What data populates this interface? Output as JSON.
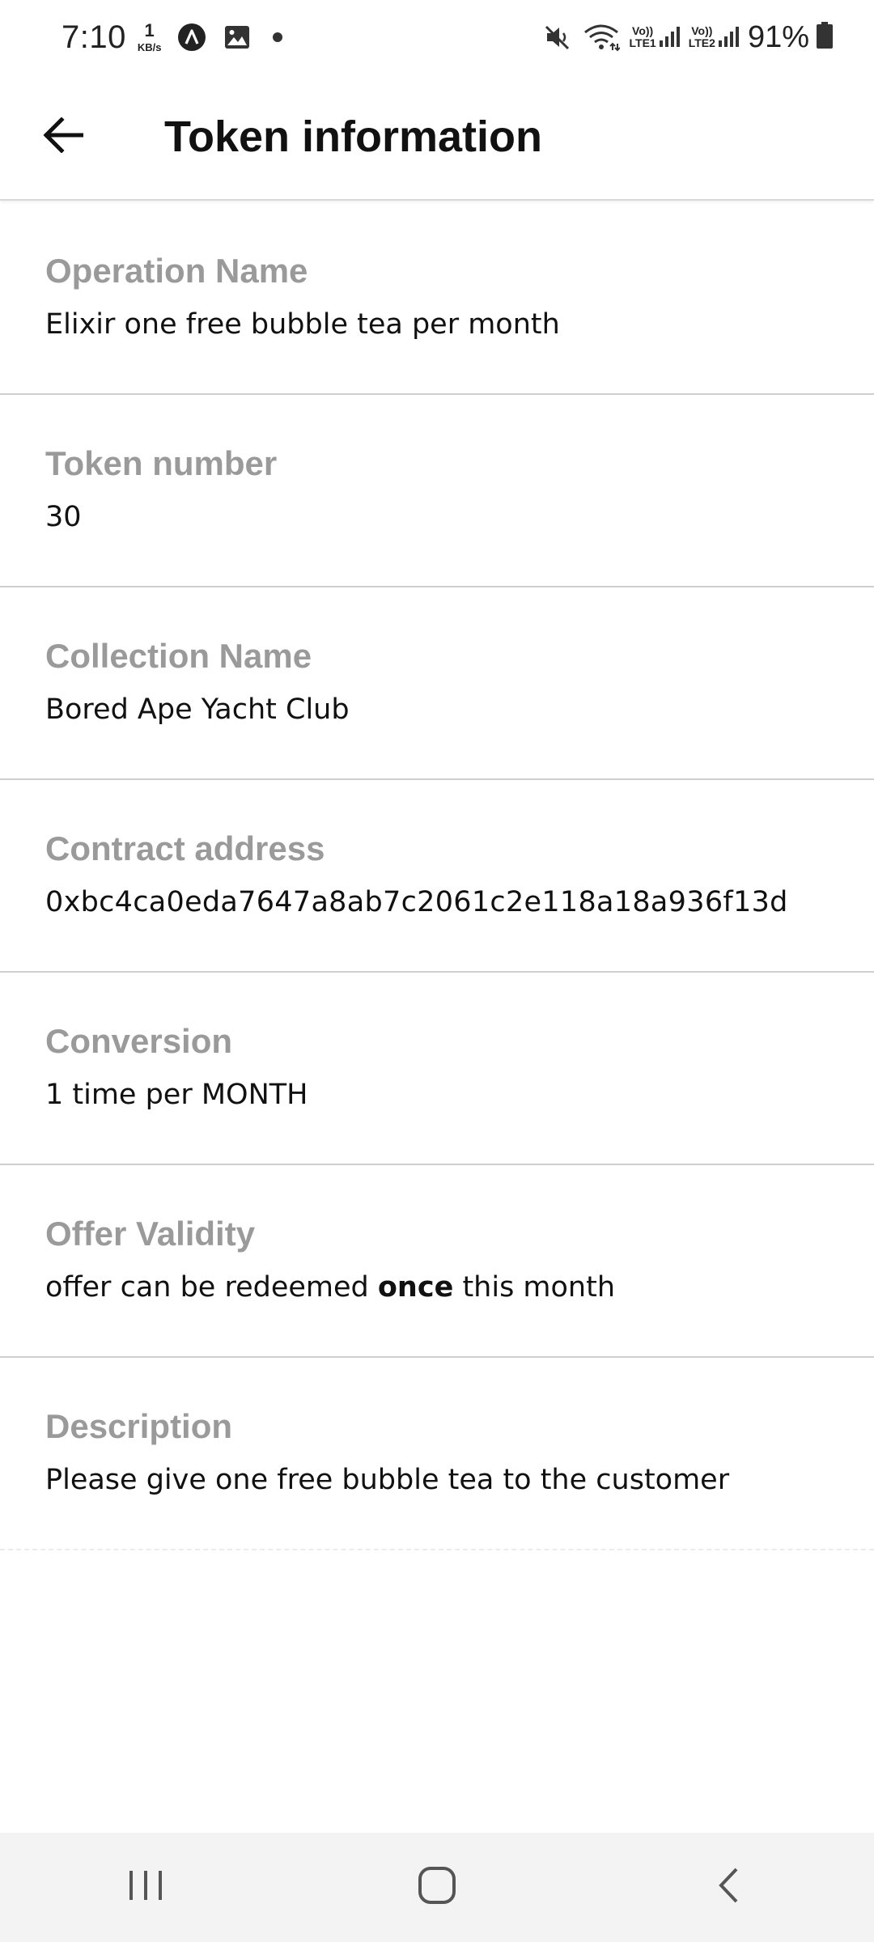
{
  "status_bar": {
    "time": "7:10",
    "net_speed_value": "1",
    "net_speed_unit": "KB/s",
    "sim1_top": "Vo))",
    "sim1_bottom": "LTE1",
    "sim2_top": "Vo))",
    "sim2_bottom": "LTE2",
    "battery_percent": "91%"
  },
  "app_bar": {
    "title": "Token information",
    "back_icon": "arrow-left-icon"
  },
  "fields": [
    {
      "label": "Operation Name",
      "value": "Elixir one free bubble tea per month"
    },
    {
      "label": "Token number",
      "value": "30"
    },
    {
      "label": "Collection Name",
      "value": "Bored Ape Yacht Club"
    },
    {
      "label": "Contract address",
      "value": "0xbc4ca0eda7647a8ab7c2061c2e118a18a936f13d"
    },
    {
      "label": "Conversion",
      "value": "1 time per MONTH"
    },
    {
      "label": "Offer Validity",
      "value_before": "offer can be redeemed ",
      "value_bold": "once",
      "value_after": " this month"
    },
    {
      "label": "Description",
      "value": "Please give one free bubble tea to the customer"
    }
  ],
  "nav_bar": {
    "icons": [
      "recent-apps-icon",
      "home-icon",
      "back-icon"
    ]
  }
}
